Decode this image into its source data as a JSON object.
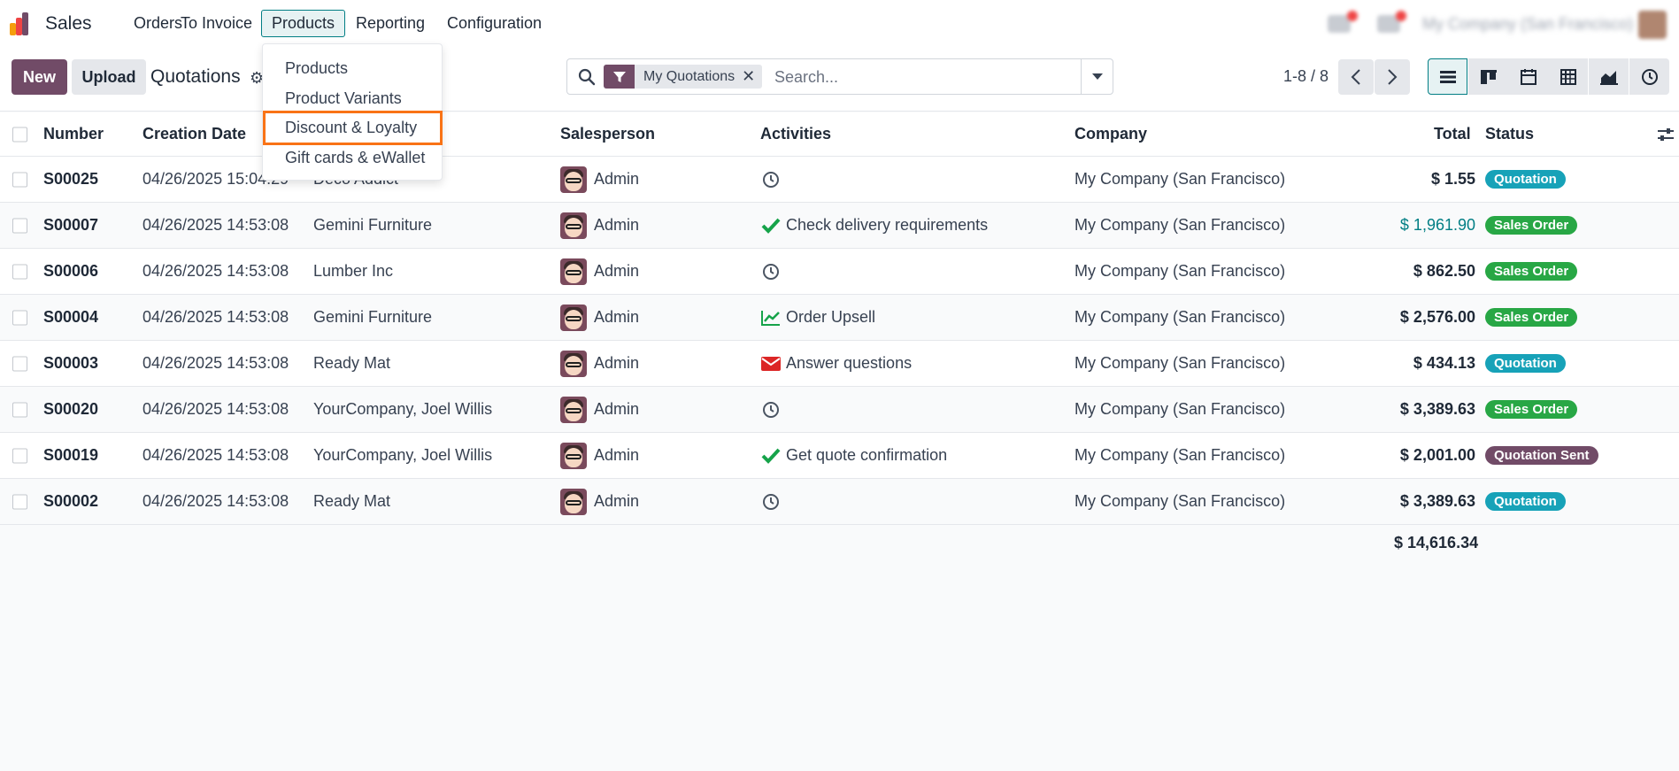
{
  "app": {
    "name": "Sales"
  },
  "nav": {
    "menus": [
      {
        "label": "Orders"
      },
      {
        "label": "To Invoice"
      },
      {
        "label": "Products"
      },
      {
        "label": "Reporting"
      },
      {
        "label": "Configuration"
      }
    ],
    "company_name": "My Company (San Francisco)"
  },
  "products_menu": {
    "items": [
      {
        "label": "Products"
      },
      {
        "label": "Product Variants"
      },
      {
        "label": "Discount & Loyalty"
      },
      {
        "label": "Gift cards & eWallet"
      }
    ]
  },
  "control": {
    "new_label": "New",
    "upload_label": "Upload",
    "breadcrumb": "Quotations",
    "facet_label": "My Quotations",
    "search_placeholder": "Search...",
    "pager": "1-8 / 8"
  },
  "table": {
    "headers": {
      "number": "Number",
      "creation_date": "Creation Date",
      "salesperson": "Salesperson",
      "activities": "Activities",
      "company": "Company",
      "total": "Total",
      "status": "Status"
    },
    "rows": [
      {
        "number": "S00025",
        "date": "04/26/2025 15:04:29",
        "customer": "Deco Addict",
        "salesperson": "Admin",
        "activity": "",
        "activity_icon": "clock-icon",
        "company": "My Company (San Francisco)",
        "total": "$ 1.55",
        "status": "Quotation"
      },
      {
        "number": "S00007",
        "date": "04/26/2025 14:53:08",
        "customer": "Gemini Furniture",
        "salesperson": "Admin",
        "activity": "Check delivery requirements",
        "activity_icon": "check-icon",
        "company": "My Company (San Francisco)",
        "total": "$ 1,961.90",
        "status": "Sales Order"
      },
      {
        "number": "S00006",
        "date": "04/26/2025 14:53:08",
        "customer": "Lumber Inc",
        "salesperson": "Admin",
        "activity": "",
        "activity_icon": "clock-icon",
        "company": "My Company (San Francisco)",
        "total": "$ 862.50",
        "status": "Sales Order"
      },
      {
        "number": "S00004",
        "date": "04/26/2025 14:53:08",
        "customer": "Gemini Furniture",
        "salesperson": "Admin",
        "activity": "Order Upsell",
        "activity_icon": "upsell-chart-icon",
        "company": "My Company (San Francisco)",
        "total": "$ 2,576.00",
        "status": "Sales Order"
      },
      {
        "number": "S00003",
        "date": "04/26/2025 14:53:08",
        "customer": "Ready Mat",
        "salesperson": "Admin",
        "activity": "Answer questions",
        "activity_icon": "envelope-icon",
        "company": "My Company (San Francisco)",
        "total": "$ 434.13",
        "status": "Quotation"
      },
      {
        "number": "S00020",
        "date": "04/26/2025 14:53:08",
        "customer": "YourCompany, Joel Willis",
        "salesperson": "Admin",
        "activity": "",
        "activity_icon": "clock-icon",
        "company": "My Company (San Francisco)",
        "total": "$ 3,389.63",
        "status": "Sales Order"
      },
      {
        "number": "S00019",
        "date": "04/26/2025 14:53:08",
        "customer": "YourCompany, Joel Willis",
        "salesperson": "Admin",
        "activity": "Get quote confirmation",
        "activity_icon": "check-icon",
        "company": "My Company (San Francisco)",
        "total": "$ 2,001.00",
        "status": "Quotation Sent"
      },
      {
        "number": "S00002",
        "date": "04/26/2025 14:53:08",
        "customer": "Ready Mat",
        "salesperson": "Admin",
        "activity": "",
        "activity_icon": "clock-icon",
        "company": "My Company (San Francisco)",
        "total": "$ 3,389.63",
        "status": "Quotation"
      }
    ],
    "grand_total": "$ 14,616.34"
  },
  "colors": {
    "brand": "#714b67",
    "accent": "#017e84",
    "quotation": "#17a2b8",
    "sales_order": "#28a745",
    "quotation_sent": "#714b67",
    "highlight": "#f97316"
  }
}
